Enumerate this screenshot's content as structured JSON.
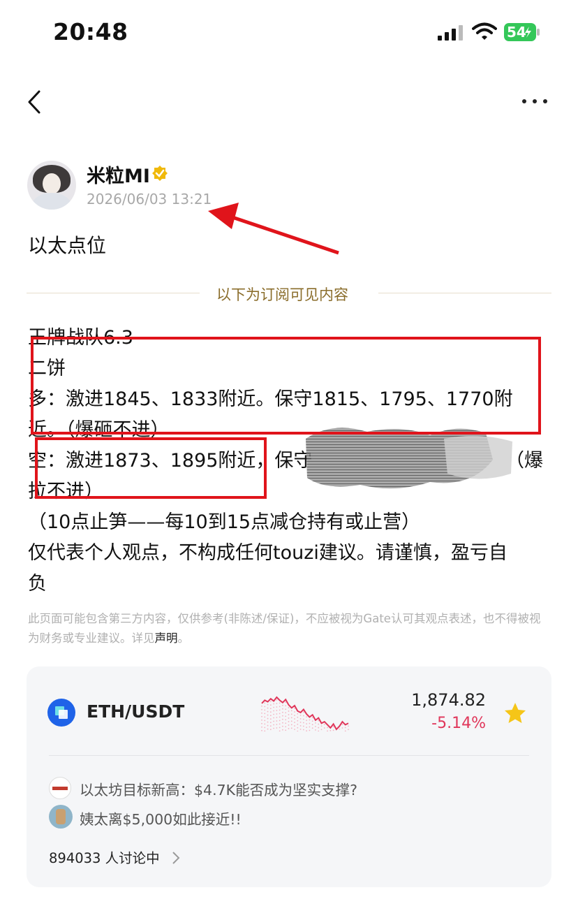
{
  "status_bar": {
    "time": "20:48",
    "battery": "54"
  },
  "author": {
    "name": "米粒MI",
    "timestamp": "2026/06/03 13:21"
  },
  "post": {
    "title": "以太点位",
    "divider_text": "以下为订阅可见内容",
    "lines": [
      "王牌战队6.3",
      "二饼",
      "多：激进1845、1833附近。保守1815、1795、1770附",
      "近。（爆砸不进）",
      "空：激进1873、1895附近，保守",
      "（爆",
      "拉不进）",
      "（10点止笋——每10到15点减仓持有或止营）",
      "仅代表个人观点，不构成任何touzi建议。请谨慎，盈亏自",
      "负"
    ],
    "disclaimer": "此页面可能包含第三方内容，仅供参考(非陈述/保证)，不应被视为Gate认可其观点表述，也不得被视为财务或专业建议。详见",
    "disclaimer_link": "声明",
    "disclaimer_end": "。"
  },
  "card": {
    "pair": "ETH/USDT",
    "price": "1,874.82",
    "change": "-5.14%",
    "news": [
      {
        "text": "以太坊目标新高：$4.7K能否成为坚实支撑?",
        "icon": "crypto-news-icon"
      },
      {
        "text": "姨太离$5,000如此接近!!",
        "icon": "user-avatar-icon"
      }
    ],
    "discussion": "894033 人讨论中"
  },
  "colors": {
    "accent_red": "#e0141b",
    "change_red": "#e0365a",
    "gold": "#8a6d2b",
    "coin_blue": "#1f63e8"
  },
  "chart_data": {
    "type": "line",
    "values": [
      62,
      66,
      64,
      68,
      65,
      70,
      66,
      63,
      67,
      60,
      56,
      59,
      52,
      50,
      54,
      48,
      44,
      47,
      40,
      43,
      36,
      38,
      34,
      30,
      35,
      28,
      32,
      38,
      34,
      36
    ]
  }
}
